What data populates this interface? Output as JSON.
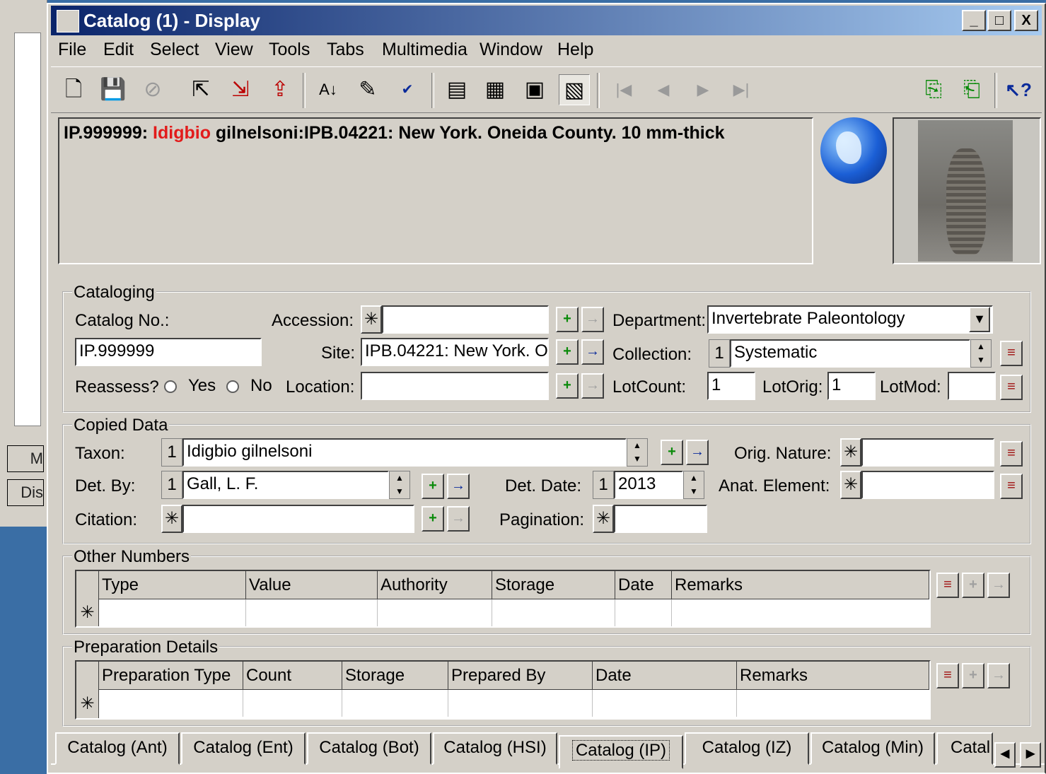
{
  "background_window": {
    "button1_label": "M",
    "button2_label": "Dis"
  },
  "window": {
    "title": "Catalog (1) - Display",
    "minimize": "_",
    "maximize": "□",
    "close": "X"
  },
  "menu": [
    "File",
    "Edit",
    "Select",
    "View",
    "Tools",
    "Tabs",
    "Multimedia",
    "Window",
    "Help"
  ],
  "toolbar_icons": [
    "new-record-icon",
    "save-icon",
    "cancel-icon",
    "import-icon",
    "export-icon",
    "export-all-icon",
    "sort-icon",
    "edit-icon",
    "spellcheck-icon",
    "form-view-icon",
    "grid-view-icon",
    "page-view-icon",
    "summary-view-icon",
    "first-record-icon",
    "previous-record-icon",
    "next-record-icon",
    "last-record-icon",
    "copy-record-icon",
    "paste-record-icon",
    "whats-this-help-icon"
  ],
  "summary": {
    "id": "IP.999999: ",
    "highlight": "Idigbio",
    "rest": " gilnelsoni:IPB.04221:  New York. Oneida County. 10 mm-thick"
  },
  "cataloging": {
    "group_label": "Cataloging",
    "catalog_no_label": "Catalog No.:",
    "catalog_no_value": "IP.999999",
    "accession_label": "Accession:",
    "site_label": "Site:",
    "site_value": "IPB.04221: New York. O",
    "location_label": "Location:",
    "reassess_label": "Reassess?",
    "yes_label": "Yes",
    "no_label": "No",
    "department_label": "Department:",
    "department_value": "Invertebrate Paleontology",
    "collection_label": "Collection:",
    "collection_num": "1",
    "collection_value": "Systematic",
    "lotcount_label": "LotCount:",
    "lotcount_value": "1",
    "lotorig_label": "LotOrig:",
    "lotorig_value": "1",
    "lotmod_label": "LotMod:"
  },
  "copied_data": {
    "group_label": "Copied Data",
    "taxon_label": "Taxon:",
    "taxon_num": "1",
    "taxon_value": "Idigbio gilnelsoni",
    "detby_label": "Det. By:",
    "detby_num": "1",
    "detby_value": "Gall, L. F.",
    "citation_label": "Citation:",
    "detdate_label": "Det. Date:",
    "detdate_num": "1",
    "detdate_value": "2013",
    "pagination_label": "Pagination:",
    "orig_nature_label": "Orig. Nature:",
    "anat_element_label": "Anat. Element:"
  },
  "other_numbers": {
    "group_label": "Other Numbers",
    "columns": [
      "Type",
      "Value",
      "Authority",
      "Storage",
      "Date",
      "Remarks"
    ]
  },
  "preparation": {
    "group_label": "Preparation Details",
    "columns": [
      "Preparation Type",
      "Count",
      "Storage",
      "Prepared By",
      "Date",
      "Remarks"
    ]
  },
  "new_row_marker": "✳",
  "tabs": [
    "Catalog (Ant)",
    "Catalog (Ent)",
    "Catalog (Bot)",
    "Catalog (HSI)",
    "Catalog (IP)",
    "Catalog (IZ)",
    "Catalog (Min)",
    "Catal"
  ],
  "active_tab": "Catalog (IP)"
}
